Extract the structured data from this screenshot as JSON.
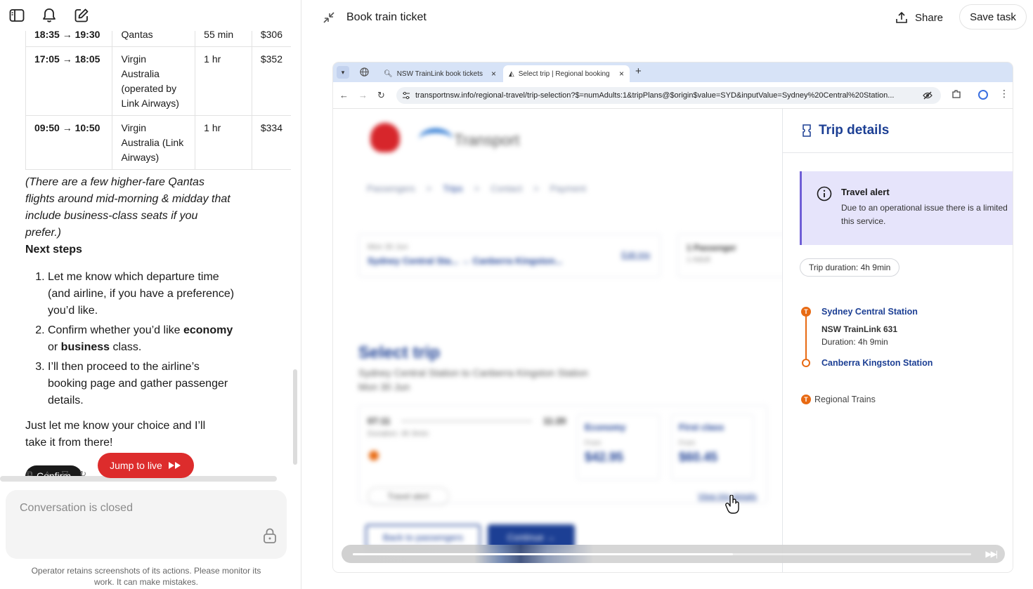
{
  "left": {
    "flights": [
      {
        "time": "18:35 → 19:30",
        "airline": "Qantas",
        "duration": "55 min",
        "price": "$306"
      },
      {
        "time": "17:05 → 18:05",
        "airline": "Virgin Australia (operated by Link Airways)",
        "duration": "1 hr",
        "price": "$352"
      },
      {
        "time": "09:50 → 10:50",
        "airline": "Virgin Australia (Link Airways)",
        "duration": "1 hr",
        "price": "$334"
      }
    ],
    "note": "(There are a few higher-fare Qantas flights around mid-morning & midday that include business-class seats if you prefer.)",
    "next_steps_heading": "Next steps",
    "step1": "Let me know which departure time (and airline, if you have a preference) you’d like.",
    "step2_a": "Confirm whether you’d like ",
    "step2_b": "economy",
    "step2_c": " or ",
    "step2_d": "business",
    "step2_e": " class.",
    "step3": "I’ll then proceed to the airline’s booking page and gather passenger details.",
    "closing": "Just let me know your choice and I’ll take it from there!",
    "confirm_label": "Confirm",
    "jump_label": "Jump to live",
    "composer_placeholder": "Conversation is closed",
    "disclaimer": "Operator retains screenshots of its actions. Please monitor its work. It can make mistakes."
  },
  "right": {
    "title": "Book train ticket",
    "share_label": "Share",
    "save_label": "Save task"
  },
  "browser": {
    "tab1_title": "NSW TrainLink book tickets",
    "tab2_title": "Select trip | Regional booking",
    "url": "transportnsw.info/regional-travel/trip-selection?$=numAdults:1&tripPlans@$origin$value=SYD&inputValue=Sydney%20Central%20Station...",
    "page": {
      "logo_text": "Transport",
      "crumbs": [
        "Passengers",
        ">",
        "Trips",
        ">",
        "Contact",
        ">",
        "Payment"
      ],
      "trip_date": "Mon 30 Jun",
      "trip_route": "Sydney Central Sta... → Canberra Kingston...",
      "edit_trip": "Edit trip",
      "passenger": "1 Passenger",
      "passenger_sub": "1 Adult",
      "select_heading": "Select trip",
      "select_sub": "Sydney Central Station to Canberra Kingston Station",
      "select_date": "Mon 30 Jun",
      "dep_time": "07:11",
      "arr_time": "11:20",
      "card_duration": "Duration: 4h 9min",
      "economy": "Economy",
      "first": "First class",
      "from": "From",
      "economy_price": "$42.95",
      "first_price": "$60.45",
      "travel_alert_pill": "Travel alert",
      "view_details": "View trip details",
      "back_btn": "Back to passengers",
      "continue_btn": "Continue →"
    },
    "side": {
      "heading": "Trip details",
      "alert_title": "Travel alert",
      "alert_msg_1": "Due to an operational issue there is a limited",
      "alert_msg_2": "this service.",
      "duration_pill": "Trip duration: 4h 9min",
      "stop_from": "Sydney Central Station",
      "service": "NSW TrainLink 631",
      "service_dur": "Duration: 4h 9min",
      "stop_to": "Canberra Kingston Station",
      "mode": "Regional Trains",
      "t_glyph": "T"
    }
  },
  "colors": {
    "nsw_blue": "#1c3f94",
    "train_orange": "#e86a13",
    "alert_purple": "#e6e4fb",
    "jump_red": "#dd2c2c"
  },
  "player": {
    "progress": 0.615
  }
}
